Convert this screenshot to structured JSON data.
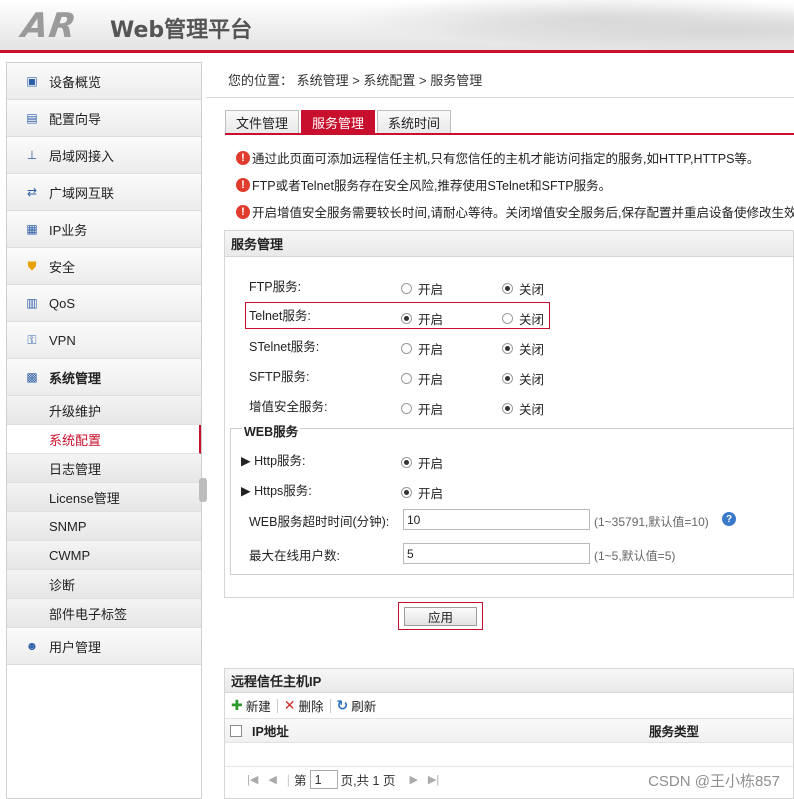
{
  "header": {
    "logo": "AR",
    "title": "Web管理平台"
  },
  "sidebar": {
    "items": [
      {
        "label": "设备概览",
        "icon": "dashboard-icon"
      },
      {
        "label": "配置向导",
        "icon": "wizard-icon"
      },
      {
        "label": "局域网接入",
        "icon": "lan-icon"
      },
      {
        "label": "广域网互联",
        "icon": "wan-icon"
      },
      {
        "label": "IP业务",
        "icon": "ip-service-icon"
      },
      {
        "label": "安全",
        "icon": "shield-icon"
      },
      {
        "label": "QoS",
        "icon": "qos-icon"
      },
      {
        "label": "VPN",
        "icon": "vpn-icon"
      },
      {
        "label": "系统管理",
        "icon": "system-icon"
      }
    ],
    "sub_items": [
      "升级维护",
      "系统配置",
      "日志管理",
      "License管理",
      "SNMP",
      "CWMP",
      "诊断",
      "部件电子标签"
    ],
    "bottom_item": {
      "label": "用户管理",
      "icon": "user-icon"
    }
  },
  "breadcrumb": "您的位置： 系统管理 > 系统配置 > 服务管理",
  "tabs": [
    "文件管理",
    "服务管理",
    "系统时间"
  ],
  "notices": [
    "通过此页面可添加远程信任主机,只有您信任的主机才能访问指定的服务,如HTTP,HTTPS等。",
    "FTP或者Telnet服务存在安全风险,推荐使用STelnet和SFTP服务。",
    "开启增值安全服务需要较长时间,请耐心等待。关闭增值安全服务后,保存配置并重启设备使修改生效。"
  ],
  "service_panel": {
    "title": "服务管理",
    "on_label": "开启",
    "off_label": "关闭",
    "rows": [
      {
        "label": "FTP服务:",
        "state": "off"
      },
      {
        "label": "Telnet服务:",
        "state": "on"
      },
      {
        "label": "STelnet服务:",
        "state": "off"
      },
      {
        "label": "SFTP服务:",
        "state": "off"
      },
      {
        "label": "增值安全服务:",
        "state": "off"
      }
    ]
  },
  "web_service": {
    "title": "WEB服务",
    "http_label": "Http服务:",
    "https_label": "Https服务:",
    "on_label": "开启",
    "timeout_label": "WEB服务超时时间(分钟):",
    "timeout_value": "10",
    "timeout_hint": "(1~35791,默认值=10)",
    "max_users_label": "最大在线用户数:",
    "max_users_value": "5",
    "max_users_hint": "(1~5,默认值=5)"
  },
  "apply_label": "应用",
  "trust_panel": {
    "title": "远程信任主机IP",
    "new_label": "新建",
    "delete_label": "删除",
    "refresh_label": "刷新",
    "col_ip": "IP地址",
    "col_service": "服务类型",
    "page_label": "第",
    "page_value": "1",
    "page_total": "页,共 1 页"
  },
  "watermark": "CSDN @王小栋857",
  "colors": {
    "accent": "#c8102e",
    "warning": "#e03c2e",
    "help": "#3a78c9"
  }
}
